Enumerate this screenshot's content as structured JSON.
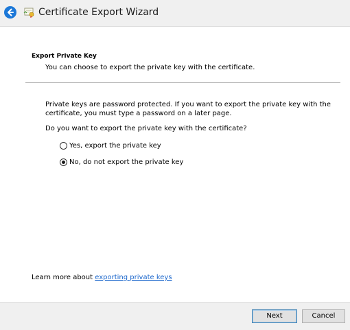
{
  "header": {
    "title": "Certificate Export Wizard",
    "back_icon": "back-arrow-icon",
    "app_icon": "certificate-icon"
  },
  "section": {
    "heading": "Export Private Key",
    "subheading": "You can choose to export the private key with the certificate."
  },
  "body": {
    "paragraph": "Private keys are password protected. If you want to export the private key with the certificate, you must type a password on a later page.",
    "question": "Do you want to export the private key with the certificate?"
  },
  "options": [
    {
      "label": "Yes, export the private key",
      "checked": false
    },
    {
      "label": "No, do not export the private key",
      "checked": true
    }
  ],
  "learn_more": {
    "prefix": "Learn more about ",
    "link_text": "exporting private keys"
  },
  "buttons": {
    "next": "Next",
    "cancel": "Cancel"
  },
  "colors": {
    "accent": "#1c78d8",
    "link": "#1a66cc",
    "chrome_bg": "#f0f0f0"
  }
}
